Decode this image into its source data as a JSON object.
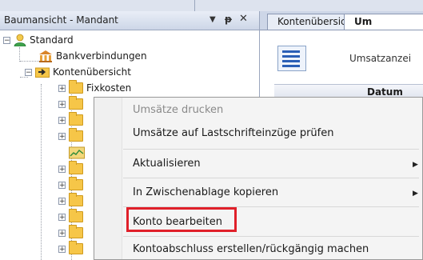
{
  "left_panel": {
    "title": "Baumansicht - Mandant",
    "controls": {
      "dropdown": "▼",
      "pin": "ᵖ",
      "close": "✕"
    },
    "tree": {
      "root": {
        "label": "Standard",
        "expander": "−"
      },
      "children": [
        {
          "label": "Bankverbindungen"
        },
        {
          "label": "Kontenübersicht",
          "expander": "−"
        }
      ],
      "sub_items": [
        {
          "label": "Fixkosten",
          "expander": "+"
        },
        {
          "label": "",
          "expander": "+"
        },
        {
          "label": "",
          "expander": "+"
        },
        {
          "label": "",
          "expander": "+"
        },
        {
          "label": ""
        },
        {
          "label": "",
          "expander": "+"
        },
        {
          "label": "",
          "expander": "+"
        },
        {
          "label": "",
          "expander": "+"
        },
        {
          "label": "",
          "expander": "+"
        },
        {
          "label": "",
          "expander": "+"
        },
        {
          "label": "",
          "expander": "+"
        }
      ]
    }
  },
  "right_panel": {
    "tabs": [
      {
        "label": "Kontenübersicht"
      },
      {
        "label": "Um"
      }
    ],
    "toolbar_label": "Umsatzanzei",
    "grid_column": "Datum"
  },
  "context_menu": {
    "items": [
      {
        "label": "Umsätze drucken",
        "disabled": true
      },
      {
        "label": "Umsätze auf Lastschrifteinzüge prüfen"
      },
      {
        "label": "Aktualisieren",
        "submenu": true
      },
      {
        "label": "In Zwischenablage kopieren",
        "submenu": true
      },
      {
        "label": "Konto bearbeiten",
        "highlighted": true
      },
      {
        "label": "Kontoabschluss erstellen/rückgängig machen"
      }
    ],
    "submenu_arrow": "▶",
    "highlight_color": "#e0202a"
  }
}
